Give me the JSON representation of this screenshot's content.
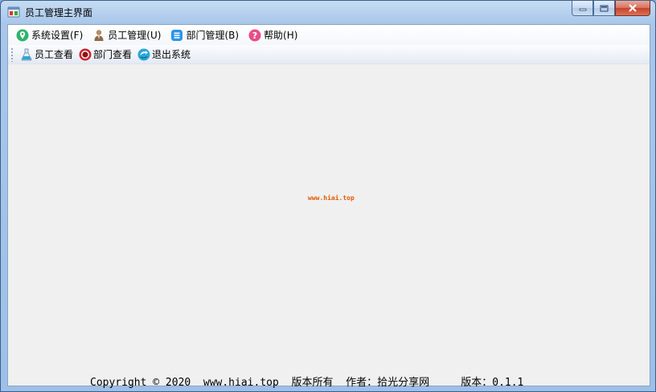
{
  "window": {
    "title": "员工管理主界面",
    "app_icon": "app-window-icon"
  },
  "menubar": {
    "items": [
      {
        "label": "系统设置(F)",
        "icon": "map-pin-icon"
      },
      {
        "label": "员工管理(U)",
        "icon": "person-icon"
      },
      {
        "label": "部门管理(B)",
        "icon": "list-icon"
      },
      {
        "label": "帮助(H)",
        "icon": "help-icon"
      }
    ]
  },
  "toolbar": {
    "items": [
      {
        "label": "员工查看",
        "icon": "flask-icon"
      },
      {
        "label": "部门查看",
        "icon": "record-icon"
      },
      {
        "label": "退出系统",
        "icon": "exit-icon"
      }
    ]
  },
  "watermark": "www.hiai.top",
  "footer": "Copyright © 2020  www.hiai.top  版本所有  作者：拾光分享网     版本：0.1.1",
  "colors": {
    "titlebar": "#a9c7ea",
    "client": "#f0f0f0",
    "watermark": "#e05a00",
    "close_button": "#c7422a"
  }
}
